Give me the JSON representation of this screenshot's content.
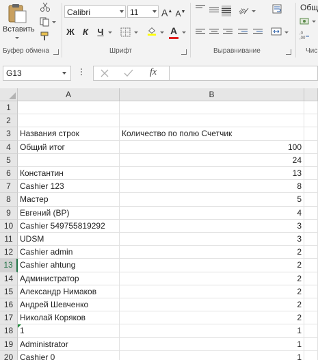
{
  "ribbon": {
    "paste_label": "Вставить",
    "font_name": "Calibri",
    "font_size": "11",
    "grow_font": "A",
    "shrink_font": "A",
    "bold": "Ж",
    "italic": "К",
    "underline": "Ч",
    "font_color_glyph": "A",
    "number_format": "Общи",
    "groups": {
      "clipboard": "Буфер обмена",
      "font": "Шрифт",
      "alignment": "Выравнивание",
      "number": "Чис"
    },
    "colors": {
      "font_color_underline": "#e02020",
      "highlight_underline": "#ffff00"
    }
  },
  "formula_bar": {
    "name_box": "G13",
    "fx": "fx",
    "formula": ""
  },
  "sheet": {
    "columns": [
      "A",
      "B"
    ],
    "rows": [
      {
        "n": "1",
        "a": "",
        "b": "",
        "b_num": false
      },
      {
        "n": "2",
        "a": "",
        "b": "",
        "b_num": false
      },
      {
        "n": "3",
        "a": "Названия строк",
        "b": "Количество по полю Счетчик",
        "b_num": false
      },
      {
        "n": "4",
        "a": "Общий итог",
        "b": "100",
        "b_num": true
      },
      {
        "n": "5",
        "a": "",
        "b": "24",
        "b_num": true
      },
      {
        "n": "6",
        "a": "Константин",
        "b": "13",
        "b_num": true
      },
      {
        "n": "7",
        "a": "Cashier 123",
        "b": "8",
        "b_num": true
      },
      {
        "n": "8",
        "a": "Мастер",
        "b": "5",
        "b_num": true
      },
      {
        "n": "9",
        "a": "Евгений (ВР)",
        "b": "4",
        "b_num": true
      },
      {
        "n": "10",
        "a": "Cashier 549755819292",
        "b": "3",
        "b_num": true
      },
      {
        "n": "11",
        "a": "UDSM",
        "b": "3",
        "b_num": true
      },
      {
        "n": "12",
        "a": "Cashier admin",
        "b": "2",
        "b_num": true
      },
      {
        "n": "13",
        "a": "Cashier ahtung",
        "b": "2",
        "b_num": true,
        "active": true
      },
      {
        "n": "14",
        "a": "Администратор",
        "b": "2",
        "b_num": true
      },
      {
        "n": "15",
        "a": "Александр Нимаков",
        "b": "2",
        "b_num": true
      },
      {
        "n": "16",
        "a": "Андрей Шевченко",
        "b": "2",
        "b_num": true
      },
      {
        "n": "17",
        "a": "Николай Коряков",
        "b": "2",
        "b_num": true
      },
      {
        "n": "18",
        "a": "1",
        "b": "1",
        "b_num": true,
        "flag": true
      },
      {
        "n": "19",
        "a": "Administrator",
        "b": "1",
        "b_num": true
      },
      {
        "n": "20",
        "a": "Cashier 0",
        "b": "1",
        "b_num": true
      }
    ]
  },
  "colors": {
    "accent": "#217346"
  }
}
